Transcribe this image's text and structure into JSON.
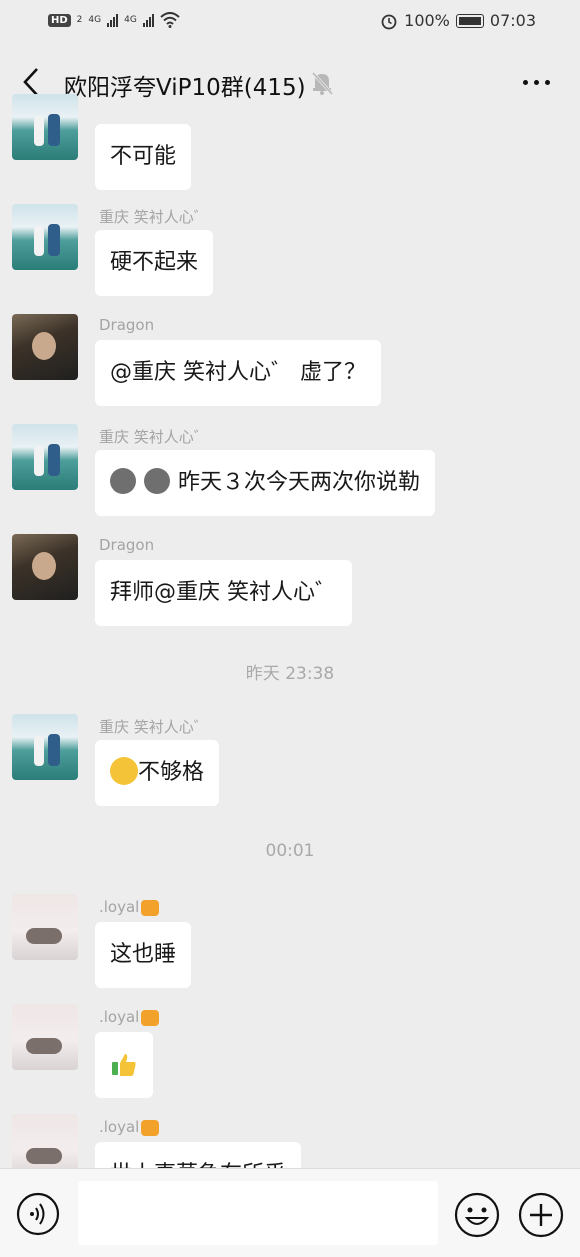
{
  "status": {
    "left": [
      "HD",
      "2",
      "4G",
      "4G"
    ],
    "battery": "100%",
    "time": "07:03"
  },
  "header": {
    "title": "欧阳浮夸ViP10群(415)"
  },
  "messages": [
    {
      "sender": "",
      "text": "不可能"
    },
    {
      "sender": "重庆  笑衬人心゛",
      "text": "硬不起来"
    },
    {
      "sender": "Dragon",
      "text": "@重庆  笑衬人心゛ 虚了？"
    },
    {
      "sender": "重庆  笑衬人心゛",
      "text": "昨天３次今天两次你说勒"
    },
    {
      "sender": "Dragon",
      "text": "拜师@重庆  笑衬人心゛"
    },
    {
      "timestamp": "昨天 23:38"
    },
    {
      "sender": "重庆  笑衬人心゛",
      "text": "不够格"
    },
    {
      "timestamp": "00:01"
    },
    {
      "sender": ".loyal",
      "text": "这也睡"
    },
    {
      "sender": ".loyal",
      "text": ""
    },
    {
      "sender": ".loyal",
      "text": "世上事莫急在所乎"
    }
  ],
  "icons": {
    "back": "back-arrow-icon",
    "mute": "bell-muted-icon",
    "more": "more-dots-icon",
    "voice": "voice-icon",
    "emoji": "emoji-icon",
    "plus": "plus-icon"
  }
}
